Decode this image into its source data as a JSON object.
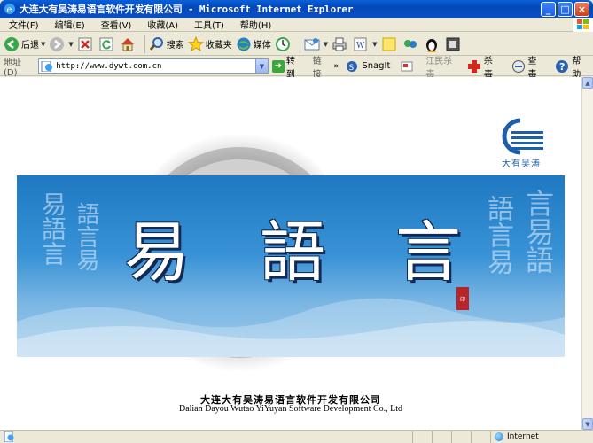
{
  "window": {
    "title": "大连大有吴涛易语言软件开发有限公司 - Microsoft Internet Explorer",
    "buttons": {
      "minimize": "_",
      "maximize": "□",
      "close": "×"
    }
  },
  "menu": [
    "文件(F)",
    "编辑(E)",
    "查看(V)",
    "收藏(A)",
    "工具(T)",
    "帮助(H)"
  ],
  "toolbar": {
    "back": "后退",
    "search": "搜索",
    "favorites": "收藏夹",
    "media": "媒体"
  },
  "address": {
    "label": "地址(D)",
    "url": "http://www.dywt.com.cn",
    "go": "转到",
    "links": "链接",
    "snagit": "SnagIt",
    "jiangmin": "江民杀毒",
    "kill": "杀毒",
    "check": "查毒",
    "help": "帮助"
  },
  "page": {
    "logo_text": "大有吴涛",
    "title_chars": [
      "易",
      "語",
      "言"
    ],
    "seal": "印",
    "company_cn": "大连大有吴涛易语言软件开发有限公司",
    "company_en": "Dalian Dayou Wutao YiYuyan Software Development Co., Ltd"
  },
  "status": {
    "zone": "Internet"
  },
  "colors": {
    "titlebar": "#0a5fd8",
    "banner": "#3a93d6",
    "logo": "#1f5fa8"
  }
}
